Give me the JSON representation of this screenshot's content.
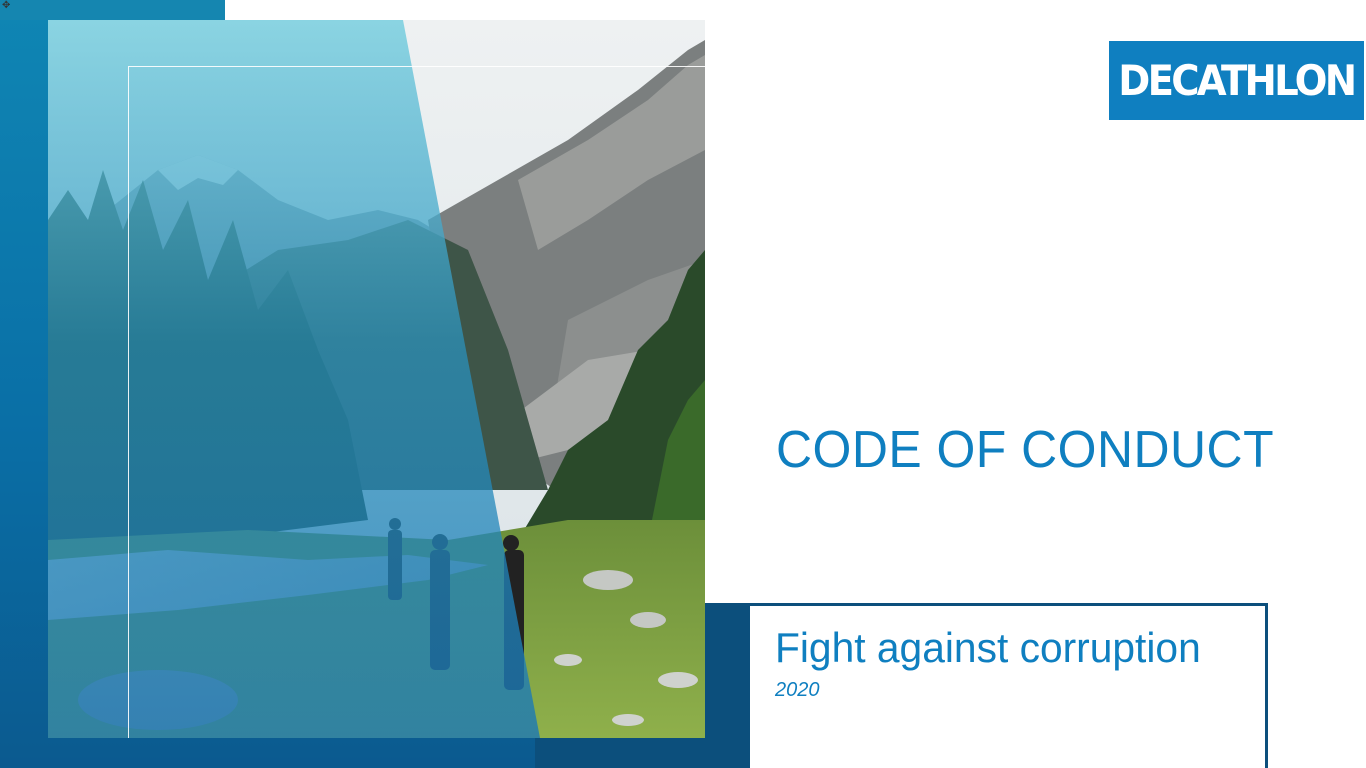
{
  "slide": {
    "logo_text": "DECATHLON",
    "title": "CODE OF CONDUCT",
    "subtitle": "Fight against corruption",
    "year": "2020"
  },
  "colors": {
    "brand_blue": "#0f7fc0",
    "dark_navy": "#0c4f7c",
    "frame_blue": "#0a6fa6",
    "overlay_cyan": "#3ab6d2"
  },
  "image": {
    "subject": "mountain-valley-hikers-photo",
    "overlay": "translucent-blue-diagonal-panel"
  },
  "icons": {
    "cursor": "mouse-cursor-icon"
  }
}
